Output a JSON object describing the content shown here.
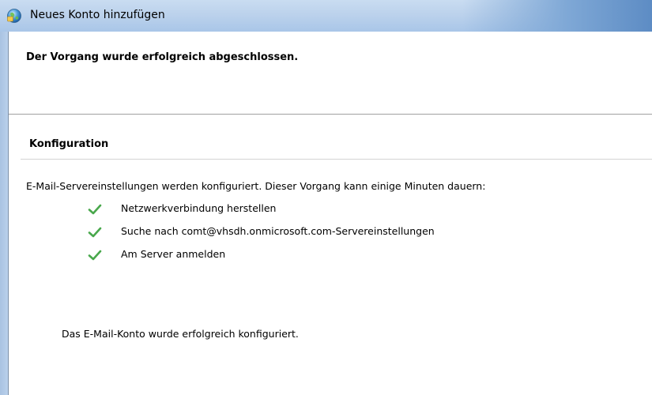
{
  "window": {
    "title": "Neues Konto hinzufügen",
    "icon": "outlook-account-icon"
  },
  "header": {
    "title": "Der Vorgang wurde erfolgreich abgeschlossen."
  },
  "configuration": {
    "section_title": "Konfiguration",
    "description": "E-Mail-Servereinstellungen werden konfiguriert. Dieser Vorgang kann einige Minuten dauern:",
    "steps": [
      {
        "label": "Netzwerkverbindung herstellen",
        "status": "done",
        "icon": "check-icon"
      },
      {
        "label": "Suche nach comt@vhsdh.onmicrosoft.com-Servereinstellungen",
        "status": "done",
        "icon": "check-icon"
      },
      {
        "label": "Am Server anmelden",
        "status": "done",
        "icon": "check-icon"
      }
    ],
    "result": "Das E-Mail-Konto wurde erfolgreich konfiguriert."
  },
  "colors": {
    "check": "#4caf50",
    "titlebar": "#bcd2ec"
  }
}
